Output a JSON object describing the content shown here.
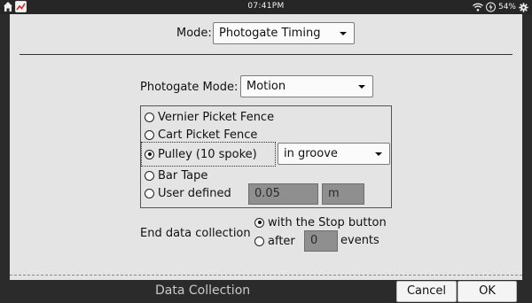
{
  "status_bar": {
    "time": "07:41PM",
    "battery": "54%",
    "icons": [
      "home-icon",
      "app-icon",
      "wifi-icon",
      "charging-icon",
      "settings-icon"
    ]
  },
  "mode": {
    "label": "Mode:",
    "value": "Photogate Timing"
  },
  "photogate_mode": {
    "label": "Photogate Mode:",
    "value": "Motion"
  },
  "options": {
    "vernier": "Vernier Picket Fence",
    "cart": "Cart Picket Fence",
    "pulley": "Pulley (10 spoke)",
    "pulley_select": "in groove",
    "bar_tape": "Bar Tape",
    "user_defined": "User defined",
    "user_value": "0.05",
    "user_unit": "m",
    "selected": "pulley"
  },
  "end_collection": {
    "label": "End data collection",
    "stop_option": "with the Stop button",
    "after_label": "after",
    "after_value": "0",
    "events_label": "events",
    "selected": "stop"
  },
  "bottom_bar": {
    "title": "Data Collection",
    "cancel": "Cancel",
    "ok": "OK"
  }
}
